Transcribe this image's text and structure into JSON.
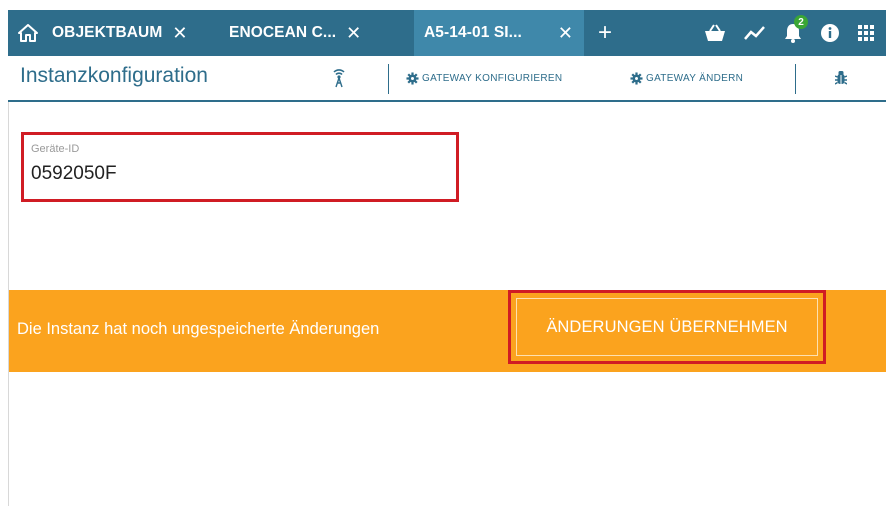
{
  "tabs": [
    {
      "label": "OBJEKTBAUM",
      "close": "✕"
    },
    {
      "label": "ENOCEAN C...",
      "close": "✕"
    },
    {
      "label": "A5-14-01 SI...",
      "close": "✕"
    }
  ],
  "tab_add": "+",
  "notifications": {
    "count": "2"
  },
  "toolbar": {
    "title": "Instanzkonfiguration",
    "configure_gateway": "GATEWAY KONFIGURIEREN",
    "change_gateway": "GATEWAY ÄNDERN"
  },
  "device_field": {
    "label": "Geräte-ID",
    "value": "0592050F"
  },
  "banner": {
    "message": "Die Instanz hat noch ungespeicherte Änderungen",
    "apply_label": "ÄNDERUNGEN ÜBERNEHMEN"
  },
  "colors": {
    "primary": "#2e6d8b",
    "active_tab": "#3f88aa",
    "banner": "#fba31e",
    "highlight": "#d01c24",
    "badge": "#3aa635"
  }
}
